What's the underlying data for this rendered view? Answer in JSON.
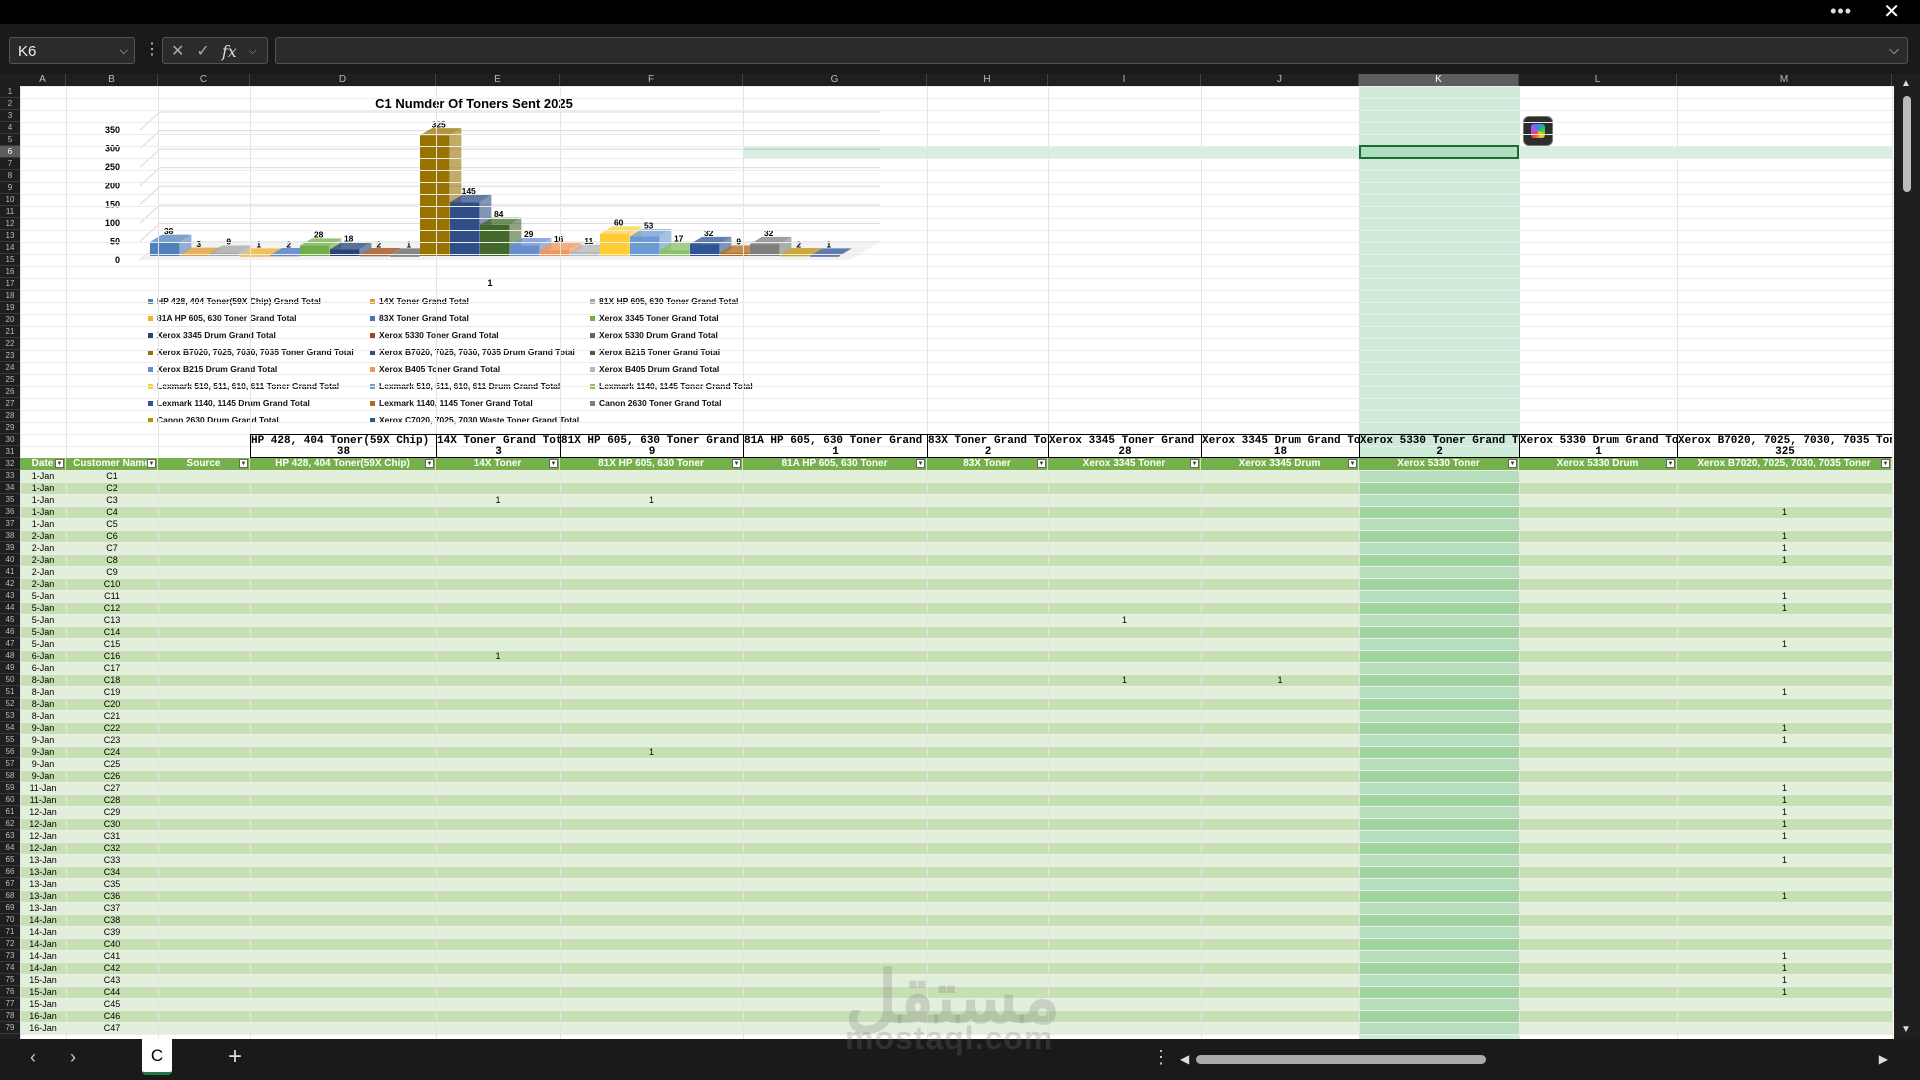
{
  "window": {
    "more_label": "•••",
    "close_label": "✕"
  },
  "formula_bar": {
    "name_box": "K6",
    "formula": "",
    "fx_label": "fx"
  },
  "columns": [
    {
      "letter": "A",
      "w": 46
    },
    {
      "letter": "B",
      "w": 92
    },
    {
      "letter": "C",
      "w": 92
    },
    {
      "letter": "D",
      "w": 186
    },
    {
      "letter": "E",
      "w": 124
    },
    {
      "letter": "F",
      "w": 183
    },
    {
      "letter": "G",
      "w": 184
    },
    {
      "letter": "H",
      "w": 121
    },
    {
      "letter": "I",
      "w": 153
    },
    {
      "letter": "J",
      "w": 158
    },
    {
      "letter": "K",
      "w": 160
    },
    {
      "letter": "L",
      "w": 158
    },
    {
      "letter": "M",
      "w": 215
    }
  ],
  "selected_column": "K",
  "chart_data": {
    "type": "bar",
    "title": "C1 Numder Of Toners Sent 2025",
    "xlabel": "1",
    "ylim": [
      0,
      350
    ],
    "yticks": [
      0,
      50,
      100,
      150,
      200,
      250,
      300,
      350
    ],
    "series": [
      {
        "name": "HP 428, 404 Toner(59X Chip) Grand Total",
        "value": 38,
        "color": "#4f81bd"
      },
      {
        "name": "14X Toner Grand Total",
        "value": 3,
        "color": "#e39b2f"
      },
      {
        "name": "81X HP 605, 630 Toner Grand Total",
        "value": 9,
        "color": "#a5a5a5"
      },
      {
        "name": "81A HP 605, 630 Toner Grand Total",
        "value": 1,
        "color": "#f0b323"
      },
      {
        "name": "83X Toner Grand Total",
        "value": 2,
        "color": "#4472c4"
      },
      {
        "name": "Xerox 3345 Toner Grand Total",
        "value": 28,
        "color": "#70ad47"
      },
      {
        "name": "Xerox 3345 Drum Grand Total",
        "value": 18,
        "color": "#264478"
      },
      {
        "name": "Xerox 5330 Toner Grand Total",
        "value": 2,
        "color": "#9e480e"
      },
      {
        "name": "Xerox 5330 Drum Grand Total",
        "value": 1,
        "color": "#636363"
      },
      {
        "name": "Xerox B7020, 7025, 7030, 7035 Toner Grand Total",
        "value": 325,
        "color": "#997300"
      },
      {
        "name": "Xerox B7020, 7025, 7030, 7035 Drum Grand Total",
        "value": 145,
        "color": "#2f4e87"
      },
      {
        "name": "Xerox B215 Toner Grand Total",
        "value": 84,
        "color": "#43682b"
      },
      {
        "name": "Xerox B215 Drum Grand Total",
        "value": 29,
        "color": "#698ed0"
      },
      {
        "name": "Xerox B405 Toner Grand Total",
        "value": 16,
        "color": "#f1975a"
      },
      {
        "name": "Xerox B405 Drum Grand Total",
        "value": 11,
        "color": "#b7b7b7"
      },
      {
        "name": "Lexmark 510, 511, 610, 611 Toner Grand Total",
        "value": 60,
        "color": "#ffcd33"
      },
      {
        "name": "Lexmark 510, 511, 610, 611 Drum Grand Total",
        "value": 53,
        "color": "#6b9bd2"
      },
      {
        "name": "Lexmark 1140, 1145 Toner Grand Total",
        "value": 17,
        "color": "#8cc168"
      },
      {
        "name": "Lexmark 1140, 1145 Drum Grand Total",
        "value": 32,
        "color": "#2e5597"
      },
      {
        "name": "Lexmark 1140, 1145 Toner Grand Total",
        "value": 9,
        "color": "#b26a1e"
      },
      {
        "name": "Canon 2630 Toner Grand Total",
        "value": 32,
        "color": "#7f7f7f"
      },
      {
        "name": "Canon 2630 Drum Grand Total",
        "value": 2,
        "color": "#bf8f00"
      },
      {
        "name": "Xerox C7020, 7025, 7030 Waste Toner Grand Total",
        "value": 1,
        "color": "#2f5597"
      }
    ]
  },
  "totals_row": [
    {
      "col": "D",
      "label": "HP 428, 404 Toner(59X Chip) Grand Total",
      "value": "38"
    },
    {
      "col": "E",
      "label": "14X Toner Grand Total",
      "value": "3"
    },
    {
      "col": "F",
      "label": "81X HP 605, 630 Toner Grand Total",
      "value": "9"
    },
    {
      "col": "G",
      "label": "81A HP 605, 630 Toner Grand Total",
      "value": "1"
    },
    {
      "col": "H",
      "label": "83X Toner Grand Total",
      "value": "2"
    },
    {
      "col": "I",
      "label": "Xerox 3345 Toner Grand Total",
      "value": "28"
    },
    {
      "col": "J",
      "label": "Xerox 3345 Drum Grand Total",
      "value": "18"
    },
    {
      "col": "K",
      "label": "Xerox 5330 Toner Grand Total",
      "value": "2"
    },
    {
      "col": "L",
      "label": "Xerox 5330 Drum Grand Total",
      "value": "1"
    },
    {
      "col": "M",
      "label": "Xerox B7020, 7025, 7030, 7035 Toner Grand Total",
      "value": "325"
    }
  ],
  "table_headers": [
    "Date",
    "Customer Name",
    "Source",
    "HP 428, 404 Toner(59X Chip)",
    "14X Toner",
    "81X HP 605, 630 Toner",
    "81A HP 605, 630 Toner",
    "83X Toner",
    "Xerox 3345 Toner",
    "Xerox 3345 Drum",
    "Xerox 5330 Toner",
    "Xerox 5330 Drum",
    "Xerox B7020, 7025, 7030, 7035 Toner"
  ],
  "table_rows": [
    [
      "1-Jan",
      "C1",
      "",
      "",
      "",
      "",
      "",
      "",
      "",
      "",
      "",
      "",
      ""
    ],
    [
      "1-Jan",
      "C2",
      "",
      "",
      "",
      "",
      "",
      "",
      "",
      "",
      "",
      "",
      ""
    ],
    [
      "1-Jan",
      "C3",
      "",
      "",
      "1",
      "1",
      "",
      "",
      "",
      "",
      "",
      "",
      ""
    ],
    [
      "1-Jan",
      "C4",
      "",
      "",
      "",
      "",
      "",
      "",
      "",
      "",
      "",
      "",
      "1"
    ],
    [
      "1-Jan",
      "C5",
      "",
      "",
      "",
      "",
      "",
      "",
      "",
      "",
      "",
      "",
      ""
    ],
    [
      "2-Jan",
      "C6",
      "",
      "",
      "",
      "",
      "",
      "",
      "",
      "",
      "",
      "",
      "1"
    ],
    [
      "2-Jan",
      "C7",
      "",
      "",
      "",
      "",
      "",
      "",
      "",
      "",
      "",
      "",
      "1"
    ],
    [
      "2-Jan",
      "C8",
      "",
      "",
      "",
      "",
      "",
      "",
      "",
      "",
      "",
      "",
      "1"
    ],
    [
      "2-Jan",
      "C9",
      "",
      "",
      "",
      "",
      "",
      "",
      "",
      "",
      "",
      "",
      ""
    ],
    [
      "2-Jan",
      "C10",
      "",
      "",
      "",
      "",
      "",
      "",
      "",
      "",
      "",
      "",
      ""
    ],
    [
      "5-Jan",
      "C11",
      "",
      "",
      "",
      "",
      "",
      "",
      "",
      "",
      "",
      "",
      "1"
    ],
    [
      "5-Jan",
      "C12",
      "",
      "",
      "",
      "",
      "",
      "",
      "",
      "",
      "",
      "",
      "1"
    ],
    [
      "5-Jan",
      "C13",
      "",
      "",
      "",
      "",
      "",
      "",
      "1",
      "",
      "",
      "",
      ""
    ],
    [
      "5-Jan",
      "C14",
      "",
      "",
      "",
      "",
      "",
      "",
      "",
      "",
      "",
      "",
      ""
    ],
    [
      "5-Jan",
      "C15",
      "",
      "",
      "",
      "",
      "",
      "",
      "",
      "",
      "",
      "",
      "1"
    ],
    [
      "6-Jan",
      "C16",
      "",
      "",
      "1",
      "",
      "",
      "",
      "",
      "",
      "",
      "",
      ""
    ],
    [
      "6-Jan",
      "C17",
      "",
      "",
      "",
      "",
      "",
      "",
      "",
      "",
      "",
      "",
      ""
    ],
    [
      "8-Jan",
      "C18",
      "",
      "",
      "",
      "",
      "",
      "",
      "1",
      "1",
      "",
      "",
      ""
    ],
    [
      "8-Jan",
      "C19",
      "",
      "",
      "",
      "",
      "",
      "",
      "",
      "",
      "",
      "",
      "1"
    ],
    [
      "8-Jan",
      "C20",
      "",
      "",
      "",
      "",
      "",
      "",
      "",
      "",
      "",
      "",
      ""
    ],
    [
      "8-Jan",
      "C21",
      "",
      "",
      "",
      "",
      "",
      "",
      "",
      "",
      "",
      "",
      ""
    ],
    [
      "9-Jan",
      "C22",
      "",
      "",
      "",
      "",
      "",
      "",
      "",
      "",
      "",
      "",
      "1"
    ],
    [
      "9-Jan",
      "C23",
      "",
      "",
      "",
      "",
      "",
      "",
      "",
      "",
      "",
      "",
      "1"
    ],
    [
      "9-Jan",
      "C24",
      "",
      "",
      "",
      "1",
      "",
      "",
      "",
      "",
      "",
      "",
      ""
    ],
    [
      "9-Jan",
      "C25",
      "",
      "",
      "",
      "",
      "",
      "",
      "",
      "",
      "",
      "",
      ""
    ],
    [
      "9-Jan",
      "C26",
      "",
      "",
      "",
      "",
      "",
      "",
      "",
      "",
      "",
      "",
      ""
    ],
    [
      "11-Jan",
      "C27",
      "",
      "",
      "",
      "",
      "",
      "",
      "",
      "",
      "",
      "",
      "1"
    ],
    [
      "11-Jan",
      "C28",
      "",
      "",
      "",
      "",
      "",
      "",
      "",
      "",
      "",
      "",
      "1"
    ],
    [
      "12-Jan",
      "C29",
      "",
      "",
      "",
      "",
      "",
      "",
      "",
      "",
      "",
      "",
      "1"
    ],
    [
      "12-Jan",
      "C30",
      "",
      "",
      "",
      "",
      "",
      "",
      "",
      "",
      "",
      "",
      "1"
    ],
    [
      "12-Jan",
      "C31",
      "",
      "",
      "",
      "",
      "",
      "",
      "",
      "",
      "",
      "",
      "1"
    ],
    [
      "12-Jan",
      "C32",
      "",
      "",
      "",
      "",
      "",
      "",
      "",
      "",
      "",
      "",
      ""
    ],
    [
      "13-Jan",
      "C33",
      "",
      "",
      "",
      "",
      "",
      "",
      "",
      "",
      "",
      "",
      "1"
    ],
    [
      "13-Jan",
      "C34",
      "",
      "",
      "",
      "",
      "",
      "",
      "",
      "",
      "",
      "",
      ""
    ],
    [
      "13-Jan",
      "C35",
      "",
      "",
      "",
      "",
      "",
      "",
      "",
      "",
      "",
      "",
      ""
    ],
    [
      "13-Jan",
      "C36",
      "",
      "",
      "",
      "",
      "",
      "",
      "",
      "",
      "",
      "",
      "1"
    ],
    [
      "13-Jan",
      "C37",
      "",
      "",
      "",
      "",
      "",
      "",
      "",
      "",
      "",
      "",
      ""
    ],
    [
      "14-Jan",
      "C38",
      "",
      "",
      "",
      "",
      "",
      "",
      "",
      "",
      "",
      "",
      ""
    ],
    [
      "14-Jan",
      "C39",
      "",
      "",
      "",
      "",
      "",
      "",
      "",
      "",
      "",
      "",
      ""
    ],
    [
      "14-Jan",
      "C40",
      "",
      "",
      "",
      "",
      "",
      "",
      "",
      "",
      "",
      "",
      ""
    ],
    [
      "14-Jan",
      "C41",
      "",
      "",
      "",
      "",
      "",
      "",
      "",
      "",
      "",
      "",
      "1"
    ],
    [
      "14-Jan",
      "C42",
      "",
      "",
      "",
      "",
      "",
      "",
      "",
      "",
      "",
      "",
      "1"
    ],
    [
      "15-Jan",
      "C43",
      "",
      "",
      "",
      "",
      "",
      "",
      "",
      "",
      "",
      "",
      "1"
    ],
    [
      "15-Jan",
      "C44",
      "",
      "",
      "",
      "",
      "",
      "",
      "",
      "",
      "",
      "",
      "1"
    ],
    [
      "15-Jan",
      "C45",
      "",
      "",
      "",
      "",
      "",
      "",
      "",
      "",
      "",
      "",
      ""
    ],
    [
      "16-Jan",
      "C46",
      "",
      "",
      "",
      "",
      "",
      "",
      "",
      "",
      "",
      "",
      ""
    ],
    [
      "16-Jan",
      "C47",
      "",
      "",
      "",
      "",
      "",
      "",
      "",
      "",
      "",
      "",
      ""
    ]
  ],
  "sheet_tabs": [
    {
      "label": "C"
    }
  ],
  "add_sheet_label": "+",
  "watermark": {
    "arabic": "مستقل",
    "latin": "mostaql.com"
  }
}
